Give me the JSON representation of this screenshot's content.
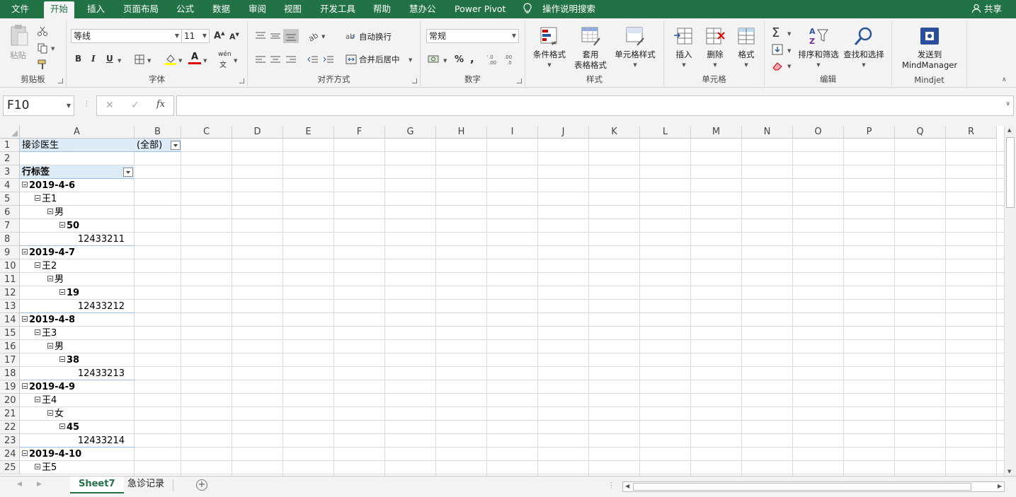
{
  "ribbon_tabs": [
    "文件",
    "开始",
    "插入",
    "页面布局",
    "公式",
    "数据",
    "审阅",
    "视图",
    "开发工具",
    "帮助",
    "慧办公",
    "Power Pivot"
  ],
  "active_tab": "开始",
  "tell_me": "操作说明搜索",
  "share": "共享",
  "clipboard": {
    "paste": "粘贴",
    "label": "剪贴板"
  },
  "font": {
    "name": "等线",
    "size": "11",
    "label": "字体",
    "bold": "B",
    "italic": "I",
    "underline": "U",
    "grow": "A",
    "shrink": "A",
    "phonetic": "wén"
  },
  "alignment": {
    "wrap": "自动换行",
    "merge": "合并后居中",
    "label": "对齐方式"
  },
  "number": {
    "format": "常规",
    "percent": "%",
    "comma": ",",
    "label": "数字"
  },
  "styles": {
    "conditional": "条件格式",
    "table_line1": "套用",
    "table_line2": "表格格式",
    "cell_styles": "单元格样式",
    "label": "样式"
  },
  "cells": {
    "insert": "插入",
    "delete": "删除",
    "format": "格式",
    "label": "单元格"
  },
  "editing": {
    "sort": "排序和筛选",
    "find": "查找和选择",
    "label": "编辑"
  },
  "mindjet": {
    "send_line1": "发送到",
    "send_line2": "MindManager",
    "label": "Mindjet"
  },
  "formula_bar": {
    "name_box": "F10",
    "fx": "fx",
    "value": ""
  },
  "columns": [
    "A",
    "B",
    "C",
    "D",
    "E",
    "F",
    "G",
    "H",
    "I",
    "J",
    "K",
    "L",
    "M",
    "N",
    "O",
    "P",
    "Q",
    "R"
  ],
  "rows": [
    "1",
    "2",
    "3",
    "4",
    "5",
    "6",
    "7",
    "8",
    "9",
    "10",
    "11",
    "12",
    "13",
    "14",
    "15",
    "16",
    "17",
    "18",
    "19",
    "20",
    "21",
    "22",
    "23",
    "24",
    "25"
  ],
  "pivot": {
    "filter_label": "接诊医生",
    "filter_value": "(全部)",
    "row_labels": "行标签",
    "lines": [
      {
        "row": 4,
        "level": 0,
        "text": "2019-4-6",
        "bold": true,
        "toggle": true
      },
      {
        "row": 5,
        "level": 1,
        "text": "王1",
        "bold": false,
        "toggle": true
      },
      {
        "row": 6,
        "level": 2,
        "text": "男",
        "bold": false,
        "toggle": true
      },
      {
        "row": 7,
        "level": 3,
        "text": "50",
        "bold": true,
        "toggle": true
      },
      {
        "row": 8,
        "level": 4,
        "text": "12433211",
        "bold": false,
        "toggle": false
      },
      {
        "row": 9,
        "level": 0,
        "text": "2019-4-7",
        "bold": true,
        "toggle": true
      },
      {
        "row": 10,
        "level": 1,
        "text": "王2",
        "bold": false,
        "toggle": true
      },
      {
        "row": 11,
        "level": 2,
        "text": "男",
        "bold": false,
        "toggle": true
      },
      {
        "row": 12,
        "level": 3,
        "text": "19",
        "bold": true,
        "toggle": true
      },
      {
        "row": 13,
        "level": 4,
        "text": "12433212",
        "bold": false,
        "toggle": false
      },
      {
        "row": 14,
        "level": 0,
        "text": "2019-4-8",
        "bold": true,
        "toggle": true
      },
      {
        "row": 15,
        "level": 1,
        "text": "王3",
        "bold": false,
        "toggle": true
      },
      {
        "row": 16,
        "level": 2,
        "text": "男",
        "bold": false,
        "toggle": true
      },
      {
        "row": 17,
        "level": 3,
        "text": "38",
        "bold": true,
        "toggle": true
      },
      {
        "row": 18,
        "level": 4,
        "text": "12433213",
        "bold": false,
        "toggle": false
      },
      {
        "row": 19,
        "level": 0,
        "text": "2019-4-9",
        "bold": true,
        "toggle": true
      },
      {
        "row": 20,
        "level": 1,
        "text": "王4",
        "bold": false,
        "toggle": true
      },
      {
        "row": 21,
        "level": 2,
        "text": "女",
        "bold": false,
        "toggle": true
      },
      {
        "row": 22,
        "level": 3,
        "text": "45",
        "bold": true,
        "toggle": true
      },
      {
        "row": 23,
        "level": 4,
        "text": "12433214",
        "bold": false,
        "toggle": false
      },
      {
        "row": 24,
        "level": 0,
        "text": "2019-4-10",
        "bold": true,
        "toggle": true
      },
      {
        "row": 25,
        "level": 1,
        "text": "王5",
        "bold": false,
        "toggle": true
      }
    ]
  },
  "sheets": [
    "Sheet7",
    "急诊记录"
  ],
  "active_sheet": "Sheet7",
  "colors": {
    "accent": "#217346",
    "pivot_header": "#ddebf7"
  }
}
